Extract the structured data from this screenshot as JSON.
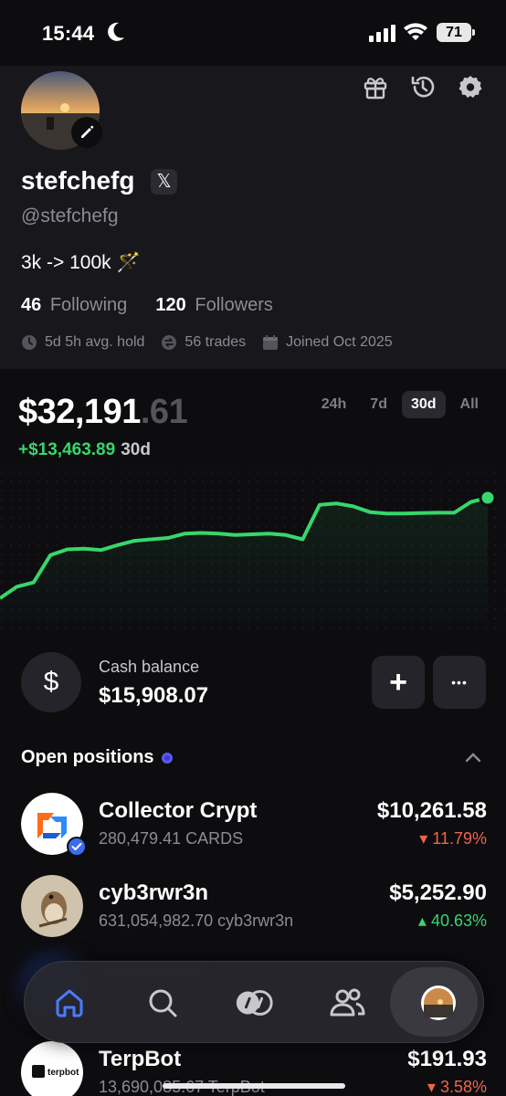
{
  "status_bar": {
    "time": "15:44",
    "battery": "71"
  },
  "profile": {
    "username": "stefchefg",
    "x_badge": "𝕏",
    "handle": "@stefchefg",
    "bio": "3k -> 100k 🪄",
    "following_count": "46",
    "following_label": "Following",
    "followers_count": "120",
    "followers_label": "Followers",
    "avg_hold": "5d 5h avg. hold",
    "trades": "56 trades",
    "joined": "Joined Oct 2025"
  },
  "portfolio": {
    "balance_main": "$32,191",
    "balance_cents": ".61",
    "gain": "+$13,463.89",
    "gain_period": "30d",
    "ranges": [
      "24h",
      "7d",
      "30d",
      "All"
    ],
    "active_range": "30d"
  },
  "chart_data": {
    "type": "line",
    "x": [
      "d1",
      "d2",
      "d3",
      "d4",
      "d5",
      "d6",
      "d7",
      "d8",
      "d9",
      "d10",
      "d11",
      "d12",
      "d13",
      "d14",
      "d15",
      "d16",
      "d17",
      "d18",
      "d19",
      "d20",
      "d21",
      "d22",
      "d23",
      "d24",
      "d25",
      "d26",
      "d27",
      "d28",
      "d29",
      "d30"
    ],
    "series": [
      {
        "values": [
          18200,
          19800,
          20400,
          24200,
          25000,
          25100,
          24900,
          25600,
          26200,
          26400,
          26600,
          27200,
          27300,
          27200,
          27000,
          27100,
          27200,
          27000,
          26400,
          31200,
          31400,
          31000,
          30200,
          30000,
          30000,
          30050,
          30100,
          30100,
          31600,
          32191
        ]
      }
    ],
    "color": "#38d66b",
    "title": "",
    "xlabel": "",
    "ylabel": ""
  },
  "cash": {
    "icon_glyph": "$",
    "label": "Cash balance",
    "value": "$15,908.07",
    "add_glyph": "+",
    "more_glyph": "•••"
  },
  "positions": {
    "title": "Open positions",
    "items": [
      {
        "name": "Collector Crypt",
        "qty": "280,479.41 CARDS",
        "value": "$10,261.58",
        "change": "▾ 11.79%",
        "direction": "down"
      },
      {
        "name": "cyb3rwr3n",
        "qty": "631,054,982.70 cyb3rwr3n",
        "value": "$5,252.90",
        "change": "▴ 40.63%",
        "direction": "up"
      },
      {
        "name": "TerpBot",
        "qty": "13,690,085.67 TerpBot",
        "value": "$191.93",
        "change": "▾ 3.58%",
        "direction": "down",
        "logo_text": "terpbot"
      }
    ]
  },
  "nav": {
    "items": [
      "home-icon",
      "search-icon",
      "coins-icon",
      "users-icon",
      "profile-avatar"
    ]
  }
}
